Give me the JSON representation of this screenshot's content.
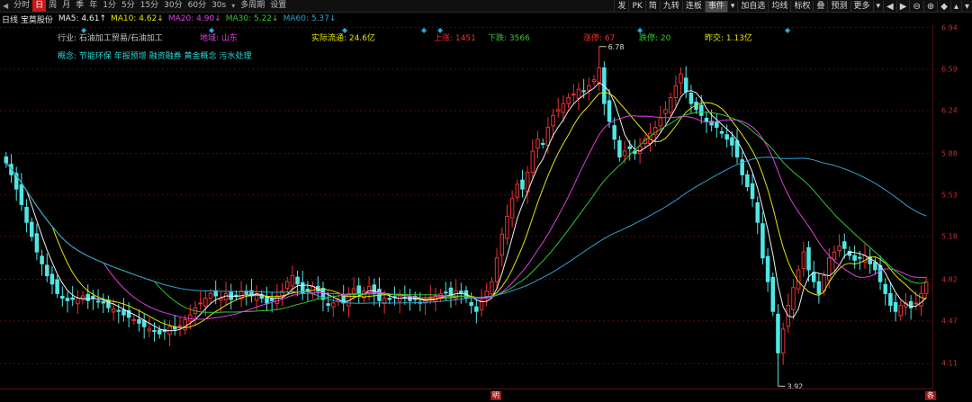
{
  "toolbar": {
    "periods": [
      {
        "label": "◀",
        "active": false
      },
      {
        "label": "分时",
        "active": false
      },
      {
        "label": "日",
        "active": true
      },
      {
        "label": "周",
        "active": false
      },
      {
        "label": "月",
        "active": false
      },
      {
        "label": "季",
        "active": false
      },
      {
        "label": "年",
        "active": false
      },
      {
        "label": "1分",
        "active": false
      },
      {
        "label": "5分",
        "active": false
      },
      {
        "label": "15分",
        "active": false
      },
      {
        "label": "30分",
        "active": false
      },
      {
        "label": "60分",
        "active": false
      },
      {
        "label": "30s",
        "active": false
      },
      {
        "label": "▾",
        "active": false
      },
      {
        "label": "多周期",
        "active": false
      },
      {
        "label": "设置",
        "active": false
      }
    ],
    "right_tools": [
      {
        "label": "发",
        "active": false
      },
      {
        "label": "PK",
        "active": false
      },
      {
        "label": "简",
        "active": false
      },
      {
        "label": "九转",
        "active": false
      },
      {
        "label": "连板",
        "active": false
      },
      {
        "label": "事件",
        "active": true
      },
      {
        "label": "▾",
        "active": false
      },
      {
        "label": "加自选",
        "active": false
      },
      {
        "label": "均线",
        "active": false
      },
      {
        "label": "标权",
        "active": false
      },
      {
        "label": "叠",
        "active": false
      },
      {
        "label": "预测",
        "active": false
      },
      {
        "label": "更多",
        "active": false
      },
      {
        "label": "▾",
        "active": false
      }
    ],
    "right_symbols": [
      "◀",
      "▶",
      "⊖",
      "⊕",
      "◆",
      "▴",
      "▾"
    ]
  },
  "ma_bar": {
    "name": "日线 宝莫股份",
    "ma5": "MA5: 4.61↑",
    "ma10": "MA10: 4.62↓",
    "ma20": "MA20: 4.90↓",
    "ma30": "MA30: 5.22↓",
    "ma60": "MA60: 5.37↓"
  },
  "info": {
    "industry": "行业: 石油加工贸易/石油加工",
    "region": "地域: 山东",
    "float_cap": "实际流通: 24.6亿",
    "up_count": "上涨: 1451",
    "down_count": "下跌: 3566",
    "limit_up": "涨停: 67",
    "limit_down": "跌停: 20",
    "prev_turnover": "昨交: 1.13亿",
    "concepts": "概念: 节能环保  年报预增  融资融券  黄金概念  污水处理"
  },
  "bottom_marks": [
    "明",
    "各"
  ],
  "colors": {
    "up": "#f03030",
    "down": "#50e6e6",
    "ma5": "#f0f0f0",
    "ma10": "#e6e600",
    "ma20": "#e040e0",
    "ma30": "#30c830",
    "ma60": "#30a0d0",
    "grid": "#4a1010",
    "axis_text": "#c03030"
  },
  "chart_data": {
    "type": "candlestick",
    "y_ticks": [
      6.94,
      6.59,
      6.24,
      5.88,
      5.53,
      5.18,
      4.82,
      4.47,
      4.11
    ],
    "ylim": [
      3.9,
      6.96
    ],
    "high_annotation": "6.78",
    "low_annotation": "3.92",
    "closes": [
      5.8,
      5.7,
      5.58,
      5.45,
      5.3,
      5.18,
      5.05,
      4.95,
      4.85,
      4.78,
      4.7,
      4.66,
      4.64,
      4.65,
      4.66,
      4.68,
      4.64,
      4.66,
      4.63,
      4.62,
      4.58,
      4.57,
      4.55,
      4.52,
      4.5,
      4.48,
      4.45,
      4.42,
      4.4,
      4.38,
      4.36,
      4.38,
      4.42,
      4.4,
      4.43,
      4.48,
      4.52,
      4.58,
      4.62,
      4.66,
      4.7,
      4.68,
      4.66,
      4.7,
      4.65,
      4.68,
      4.72,
      4.7,
      4.68,
      4.7,
      4.66,
      4.62,
      4.64,
      4.68,
      4.72,
      4.8,
      4.85,
      4.78,
      4.7,
      4.72,
      4.76,
      4.72,
      4.65,
      4.6,
      4.62,
      4.65,
      4.62,
      4.7,
      4.74,
      4.7,
      4.72,
      4.76,
      4.7,
      4.64,
      4.66,
      4.65,
      4.67,
      4.68,
      4.66,
      4.64,
      4.65,
      4.62,
      4.64,
      4.67,
      4.68,
      4.7,
      4.71,
      4.68,
      4.72,
      4.7,
      4.66,
      4.6,
      4.55,
      4.64,
      4.72,
      4.8,
      5.0,
      5.2,
      5.35,
      5.5,
      5.62,
      5.58,
      5.72,
      5.9,
      6.0,
      5.96,
      6.1,
      6.2,
      6.25,
      6.3,
      6.35,
      6.38,
      6.42,
      6.4,
      6.45,
      6.5,
      6.6,
      6.3,
      6.15,
      6.0,
      5.85,
      5.9,
      5.92,
      5.88,
      5.94,
      6.0,
      6.05,
      6.1,
      6.18,
      6.25,
      6.35,
      6.45,
      6.55,
      6.4,
      6.3,
      6.25,
      6.2,
      6.15,
      6.12,
      6.1,
      6.05,
      6.0,
      5.95,
      5.85,
      5.7,
      5.6,
      5.5,
      5.3,
      5.0,
      4.8,
      4.55,
      4.2,
      4.4,
      4.6,
      4.75,
      4.9,
      5.05,
      4.9,
      4.8,
      4.7,
      4.85,
      5.0,
      5.05,
      5.1,
      5.08,
      5.02,
      4.98,
      5.0,
      5.02,
      4.95,
      4.9,
      4.8,
      4.7,
      4.6,
      4.55,
      4.6,
      4.62,
      4.58,
      4.62,
      4.7,
      4.8
    ]
  }
}
